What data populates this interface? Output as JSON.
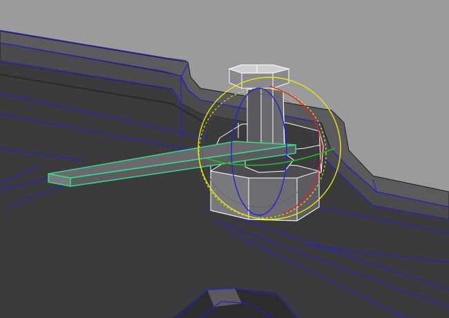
{
  "viewport": {
    "panel": "perspective",
    "background_color": "#9b9b9b",
    "wireframe_color": "#2222cc",
    "selection_color": "#33dd88",
    "highlight_edge_color": "#ffffff"
  },
  "scene": {
    "objects": [
      {
        "name": "deck",
        "display": "shaded-wireframe"
      },
      {
        "name": "capstan",
        "display": "wireframe-on-shaded",
        "state": "active"
      },
      {
        "name": "capstan-bar",
        "display": "wireframe-on-shaded",
        "state": "selected"
      },
      {
        "name": "hatch",
        "display": "shaded-wireframe"
      }
    ]
  },
  "manipulator": {
    "type": "rotate",
    "rings": [
      {
        "axis": "x",
        "color": "#dd2222"
      },
      {
        "axis": "y",
        "color": "#22bb22"
      },
      {
        "axis": "z",
        "color": "#2222dd"
      },
      {
        "axis": "view",
        "color": "#e8e800"
      }
    ]
  }
}
